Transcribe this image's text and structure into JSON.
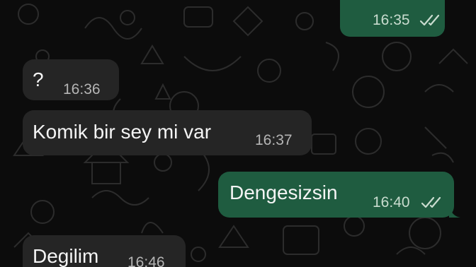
{
  "conversation": {
    "messages": [
      {
        "id": "m1",
        "direction": "outgoing",
        "text": "",
        "time": "16:35",
        "read_receipt": "double-check"
      },
      {
        "id": "m2",
        "direction": "incoming",
        "text": "?",
        "time": "16:36"
      },
      {
        "id": "m3",
        "direction": "incoming",
        "text": "Komik bir sey mi var",
        "time": "16:37"
      },
      {
        "id": "m4",
        "direction": "outgoing",
        "text": "Dengesizsin",
        "time": "16:40",
        "read_receipt": "double-check"
      },
      {
        "id": "m5",
        "direction": "incoming",
        "text": "Degilim",
        "time": "16:46"
      }
    ]
  },
  "theme": {
    "background": "#0c0c0c",
    "incoming_bubble": "#252525",
    "outgoing_bubble": "#1f5c40",
    "wallpaper_doodle": "#ffffff"
  }
}
